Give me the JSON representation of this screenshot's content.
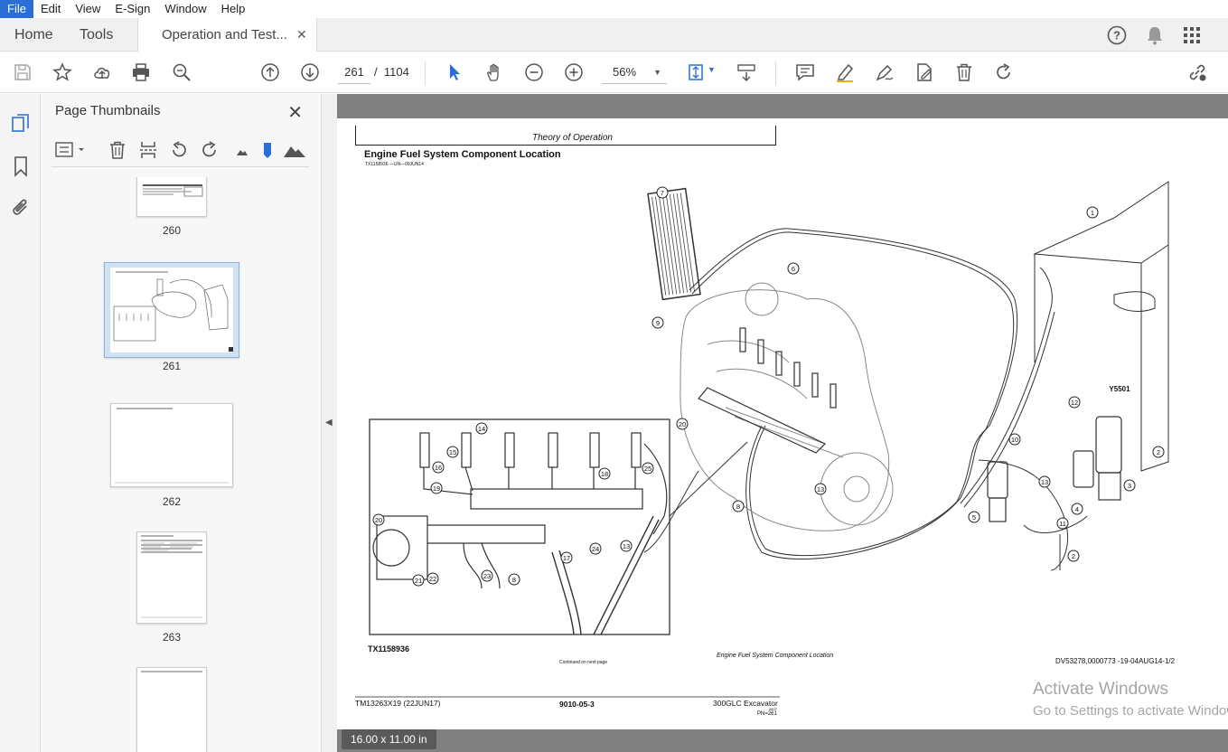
{
  "menu": [
    "File",
    "Edit",
    "View",
    "E-Sign",
    "Window",
    "Help"
  ],
  "tabs": {
    "home": "Home",
    "tools": "Tools",
    "doc": "Operation and Test...",
    "close": "✕"
  },
  "toolbar": {
    "page_current": "261",
    "page_sep": "/",
    "page_total": "1104",
    "zoom": "56%"
  },
  "panel": {
    "title": "Page Thumbnails",
    "close": "✕"
  },
  "thumbnails": [
    {
      "label": "260"
    },
    {
      "label": "261"
    },
    {
      "label": "262"
    },
    {
      "label": "263"
    }
  ],
  "document": {
    "header": "Theory of Operation",
    "title": "Engine Fuel System Component Location",
    "subref": "TX1158936 —UN—09JUN14",
    "figure_id": "TX1158936",
    "continued": "Continued on next page",
    "caption": "Engine Fuel System Component Location",
    "dv_ref": "DV53278,0000773 -19-04AUG14-1/2",
    "footer_left": "TM13263X19 (22JUN17)",
    "footer_center": "9010-05-3",
    "footer_right": "300GLC Excavator",
    "footer_right_small": "0607",
    "footer_pn": "PN=261",
    "callout_sensor": "Y5501",
    "callouts_main": [
      "1",
      "2",
      "2",
      "3",
      "4",
      "5",
      "6",
      "7",
      "8",
      "9",
      "10",
      "11",
      "12",
      "13",
      "20"
    ],
    "callouts_inset": [
      "14",
      "15",
      "16",
      "18",
      "19",
      "20",
      "21",
      "22",
      "23",
      "8",
      "17",
      "24",
      "13",
      "25"
    ]
  },
  "status": {
    "page_size": "16.00 x 11.00 in"
  },
  "watermark": {
    "line1": "Activate Windows",
    "line2": "Go to Settings to activate Windows."
  }
}
